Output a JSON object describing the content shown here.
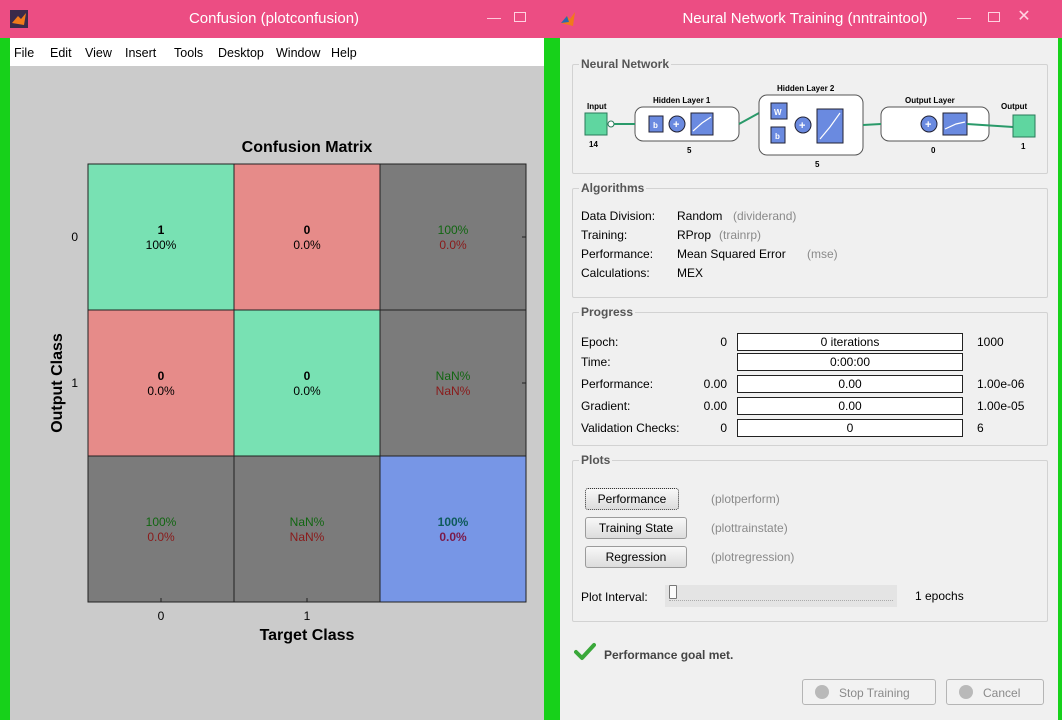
{
  "left_window": {
    "title": "Confusion (plotconfusion)",
    "menu": [
      "File",
      "Edit",
      "View",
      "Insert",
      "Tools",
      "Desktop",
      "Window",
      "Help"
    ]
  },
  "chart_data": {
    "type": "heatmap",
    "title": "Confusion Matrix",
    "xlabel": "Target Class",
    "ylabel": "Output Class",
    "x_ticks": [
      "0",
      "1"
    ],
    "y_ticks": [
      "0",
      "1"
    ],
    "cells": [
      {
        "row": 0,
        "col": 0,
        "kind": "correct",
        "count": "1",
        "pct": "100%"
      },
      {
        "row": 0,
        "col": 1,
        "kind": "wrong",
        "count": "0",
        "pct": "0.0%"
      },
      {
        "row": 0,
        "col": 2,
        "kind": "summary",
        "top": "100%",
        "bottom": "0.0%"
      },
      {
        "row": 1,
        "col": 0,
        "kind": "wrong",
        "count": "0",
        "pct": "0.0%"
      },
      {
        "row": 1,
        "col": 1,
        "kind": "correct",
        "count": "0",
        "pct": "0.0%"
      },
      {
        "row": 1,
        "col": 2,
        "kind": "summary",
        "top": "NaN%",
        "bottom": "NaN%"
      },
      {
        "row": 2,
        "col": 0,
        "kind": "summary",
        "top": "100%",
        "bottom": "0.0%"
      },
      {
        "row": 2,
        "col": 1,
        "kind": "summary",
        "top": "NaN%",
        "bottom": "NaN%"
      },
      {
        "row": 2,
        "col": 2,
        "kind": "overall",
        "top": "100%",
        "bottom": "0.0%"
      }
    ],
    "colors": {
      "correct": "#78e1b3",
      "wrong": "#e68b89",
      "summary": "#7b7b7b",
      "overall": "#7796e6",
      "green_text": "#116611",
      "red_text": "#8a1a1a",
      "overall_top": "#0e5a5a",
      "overall_bottom": "#7a1a4a"
    }
  },
  "right_window": {
    "title": "Neural Network Training (nntraintool)",
    "network": {
      "section_title": "Neural Network",
      "input_label": "Input",
      "input_size": "14",
      "hidden1_label": "Hidden Layer 1",
      "hidden1_size": "5",
      "hidden2_label": "Hidden Layer 2",
      "hidden2_size": "5",
      "output_layer_label": "Output Layer",
      "output_layer_size": "0",
      "output_label": "Output",
      "output_size": "1",
      "w_symbol": "W",
      "b_symbol": "b",
      "plus_symbol": "+"
    },
    "algorithms": {
      "section_title": "Algorithms",
      "rows": [
        {
          "label": "Data Division:",
          "value": "Random",
          "fn": "(dividerand)"
        },
        {
          "label": "Training:",
          "value": "RProp",
          "fn": "(trainrp)"
        },
        {
          "label": "Performance:",
          "value": "Mean Squared Error",
          "fn": "(mse)"
        },
        {
          "label": "Calculations:",
          "value": "MEX",
          "fn": ""
        }
      ]
    },
    "progress": {
      "section_title": "Progress",
      "rows": [
        {
          "label": "Epoch:",
          "start": "0",
          "bar": "0 iterations",
          "end": "1000"
        },
        {
          "label": "Time:",
          "start": "",
          "bar": "0:00:00",
          "end": ""
        },
        {
          "label": "Performance:",
          "start": "0.00",
          "bar": "0.00",
          "end": "1.00e-06"
        },
        {
          "label": "Gradient:",
          "start": "0.00",
          "bar": "0.00",
          "end": "1.00e-05"
        },
        {
          "label": "Validation Checks:",
          "start": "0",
          "bar": "0",
          "end": "6"
        }
      ]
    },
    "plots": {
      "section_title": "Plots",
      "buttons": [
        {
          "label": "Performance",
          "fn": "(plotperform)"
        },
        {
          "label": "Training State",
          "fn": "(plottrainstate)"
        },
        {
          "label": "Regression",
          "fn": "(plotregression)"
        }
      ],
      "interval_label": "Plot Interval:",
      "interval_value": "1 epochs"
    },
    "status": "Performance goal met.",
    "stop_label": "Stop Training",
    "cancel_label": "Cancel"
  }
}
